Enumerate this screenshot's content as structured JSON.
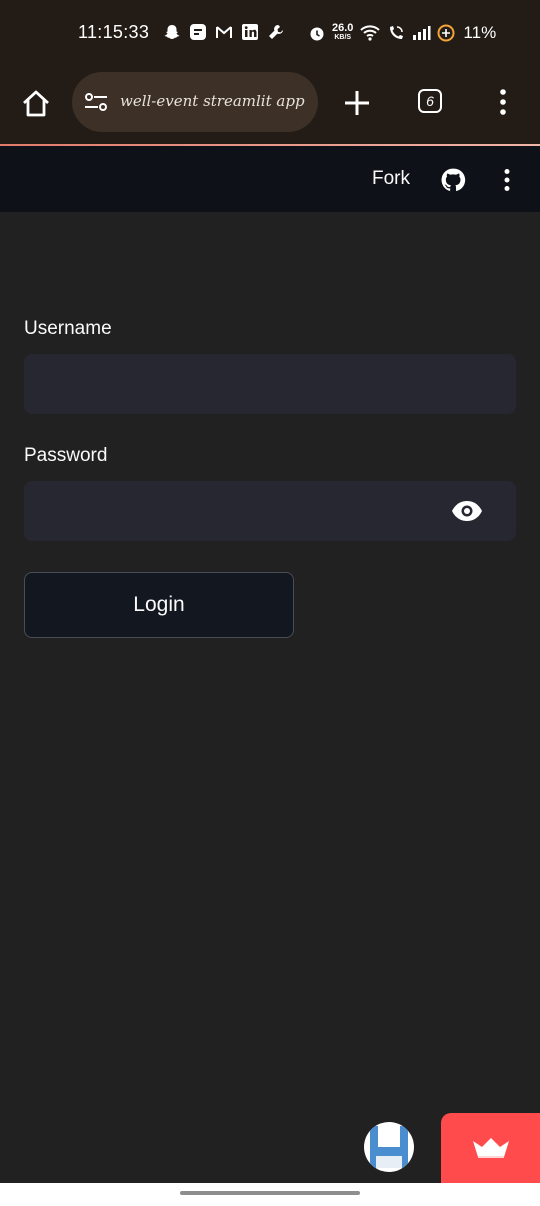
{
  "status_bar": {
    "time": "11:15:33",
    "net_speed_value": "26.0",
    "net_speed_unit": "KB/S",
    "battery": "11%"
  },
  "browser": {
    "url": "well-event streamlit app",
    "tab_count": "6",
    "accent_color": "#e27a6b"
  },
  "app_header": {
    "fork_label": "Fork"
  },
  "form": {
    "username_label": "Username",
    "username_value": "",
    "password_label": "Password",
    "password_value": "",
    "login_label": "Login"
  },
  "theme": {
    "background": "#212121",
    "input_bg": "#262730",
    "header_bg": "#0e1117",
    "brand_red": "#ff4b4b"
  },
  "icons": [
    "home-icon",
    "tune-icon",
    "plus-icon",
    "tabs-icon",
    "more-vert-icon",
    "github-icon",
    "eye-icon",
    "save-icon",
    "crown-icon"
  ]
}
